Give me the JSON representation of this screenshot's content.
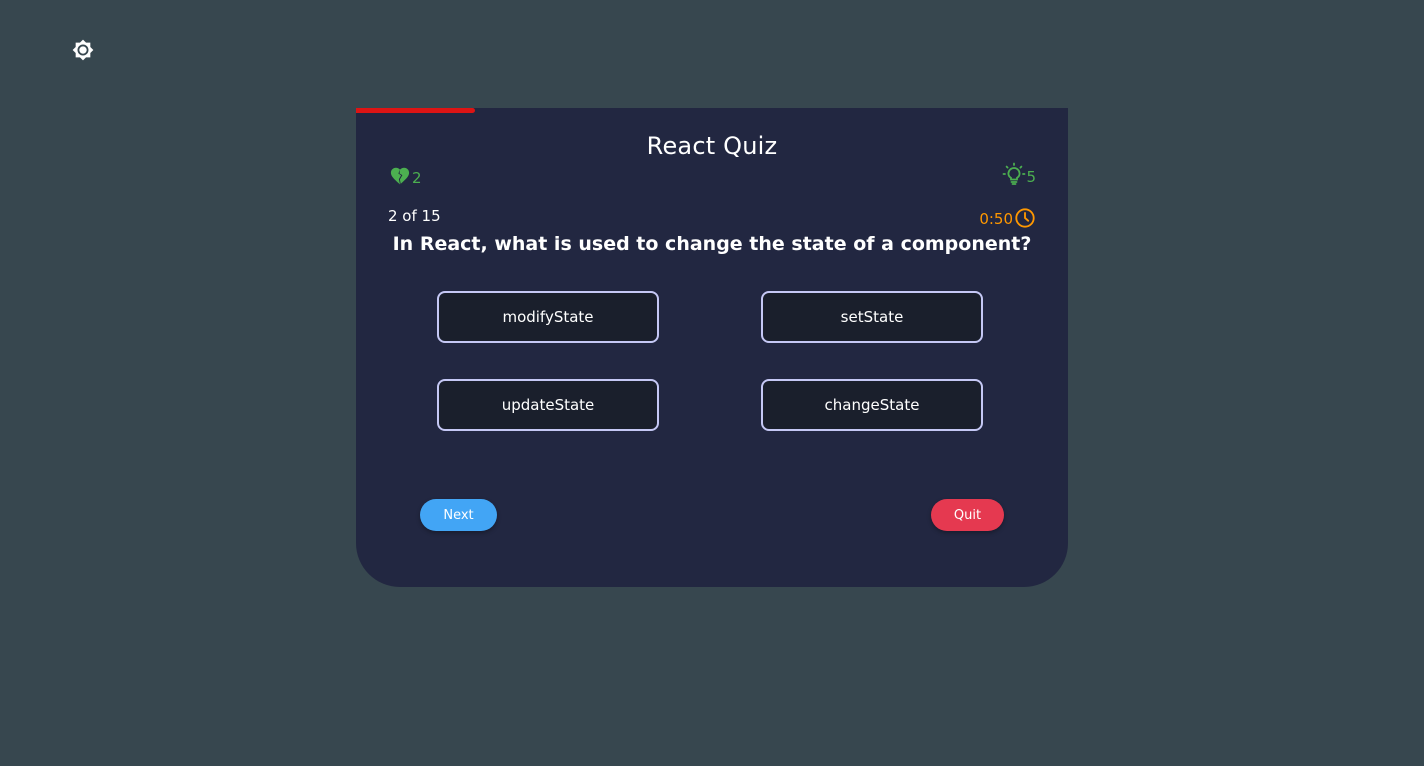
{
  "app": {
    "theme_toggle_icon": "sun-icon"
  },
  "quiz": {
    "title": "React Quiz",
    "progress_fraction": 0.1667,
    "progress_color": "#dd1414",
    "lives": {
      "icon": "heart-half-icon",
      "count": "2",
      "color": "#4caf50"
    },
    "hints": {
      "icon": "lightbulb-icon",
      "count": "5",
      "color": "#4caf50"
    },
    "counter": "2 of 15",
    "timer": {
      "time": "0:50",
      "icon": "clock-icon",
      "color": "#ff9800"
    },
    "question": "In React, what is used to change the state of a component?",
    "options": [
      {
        "label": "modifyState"
      },
      {
        "label": "setState"
      },
      {
        "label": "updateState"
      },
      {
        "label": "changeState"
      }
    ],
    "buttons": {
      "next_label": "Next",
      "next_color": "#42a5f5",
      "quit_label": "Quit",
      "quit_color": "#e53950"
    }
  }
}
